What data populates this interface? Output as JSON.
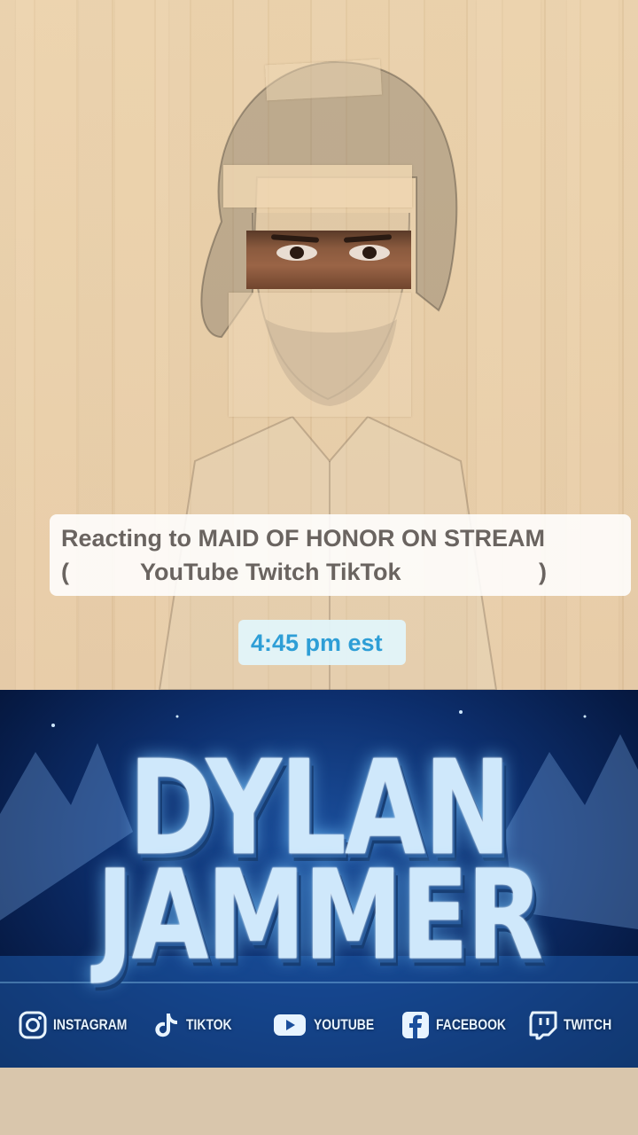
{
  "story": {
    "caption": {
      "line1": "Reacting to MAID OF HONOR ON STREAM",
      "line2_open": "(",
      "line2_platforms": "YouTube Twitch TikTok",
      "line2_close": ")"
    },
    "time": "4:45 pm est"
  },
  "banner": {
    "title_line1": "DYLAN",
    "title_line2": "JAMMER",
    "socials": [
      {
        "label": "INSTAGRAM",
        "icon": "instagram-icon"
      },
      {
        "label": "TIKTOK",
        "icon": "tiktok-icon"
      },
      {
        "label": "YOUTUBE",
        "icon": "youtube-icon"
      },
      {
        "label": "FACEBOOK",
        "icon": "facebook-icon"
      },
      {
        "label": "TWITCH",
        "icon": "twitch-icon"
      }
    ]
  },
  "colors": {
    "time_accent": "#2e9ed6",
    "banner_blue": "#0d2f6e",
    "paper": "#e9cfa8"
  }
}
